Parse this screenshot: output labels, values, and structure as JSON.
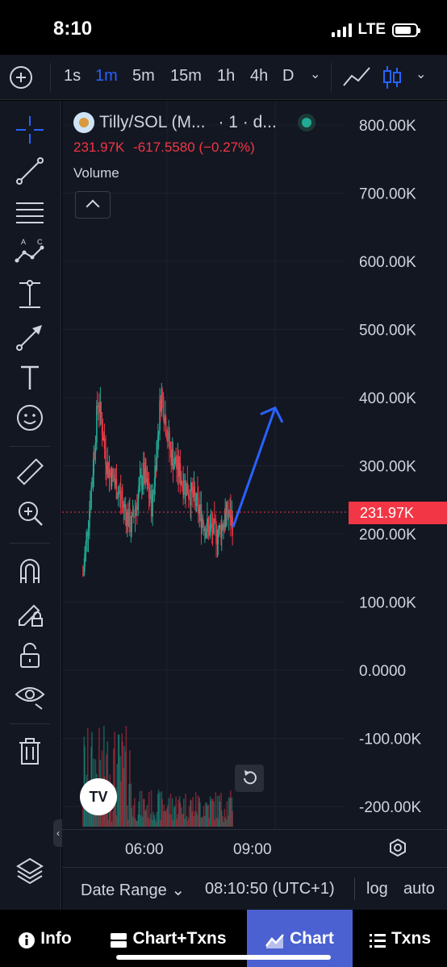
{
  "status_bar": {
    "time": "8:10",
    "network": "LTE"
  },
  "toolbar": {
    "intervals": [
      "1s",
      "1m",
      "5m",
      "15m",
      "1h",
      "4h",
      "D"
    ],
    "active_interval": "1m",
    "accent_color": "#2962ff"
  },
  "left_tools": {
    "icons": [
      "crosshair-icon",
      "trend-line-icon",
      "parallel-channel-icon",
      "pattern-icon",
      "measure-range-icon",
      "arrow-icon",
      "text-icon",
      "emoji-icon",
      "ruler-icon",
      "zoom-in-icon",
      "magnet-icon",
      "lock-drawings-icon",
      "unlock-icon",
      "eye-icon",
      "trash-icon",
      "layers-icon"
    ],
    "active_icon": "crosshair-icon",
    "pattern_labels": [
      "A",
      "C"
    ]
  },
  "legend": {
    "symbol": "Tilly/SOL (M...",
    "interval": "· 1 · d...",
    "price": "231.97K",
    "change": "-617.5580 (−0.27%)",
    "volume_label": "Volume",
    "down_color": "#f23645",
    "up_color": "#22ab94"
  },
  "chart_data": {
    "type": "candlestick",
    "y_ticks": [
      "800.00K",
      "700.00K",
      "600.00K",
      "500.00K",
      "400.00K",
      "300.00K",
      "200.00K",
      "100.00K",
      "0.0000",
      "-100.00K",
      "-200.00K"
    ],
    "ylim": [
      -200000,
      800000
    ],
    "x_ticks": [
      "06:00",
      "09:00"
    ],
    "last_price": 231970,
    "last_price_label": "231.97K",
    "series": [
      {
        "name": "Price",
        "approx_path": [
          {
            "time": "03:40",
            "value": 140000
          },
          {
            "time": "03:55",
            "value": 280000
          },
          {
            "time": "04:05",
            "value": 400000
          },
          {
            "time": "04:20",
            "value": 300000
          },
          {
            "time": "04:40",
            "value": 260000
          },
          {
            "time": "05:00",
            "value": 210000
          },
          {
            "time": "05:20",
            "value": 290000
          },
          {
            "time": "05:35",
            "value": 240000
          },
          {
            "time": "05:50",
            "value": 410000
          },
          {
            "time": "06:05",
            "value": 320000
          },
          {
            "time": "06:25",
            "value": 280000
          },
          {
            "time": "06:45",
            "value": 250000
          },
          {
            "time": "07:05",
            "value": 210000
          },
          {
            "time": "07:25",
            "value": 200000
          },
          {
            "time": "07:40",
            "value": 230000
          },
          {
            "time": "07:50",
            "value": 215000
          }
        ]
      }
    ],
    "drawing": {
      "type": "arrow",
      "from": {
        "time": "07:50",
        "value": 210000
      },
      "to": {
        "time": "09:00",
        "value": 385000
      },
      "color": "#2962ff"
    }
  },
  "time_axis": {
    "labels": [
      "06:00",
      "09:00"
    ]
  },
  "bottom_bar": {
    "date_range": "Date Range",
    "clock": "08:10:50 (UTC+1)",
    "log": "log",
    "auto": "auto"
  },
  "bottom_nav": {
    "items": [
      "Info",
      "Chart+Txns",
      "Chart",
      "Txns"
    ],
    "active": "Chart",
    "active_color": "#4b61d1"
  },
  "watermark": "TV"
}
